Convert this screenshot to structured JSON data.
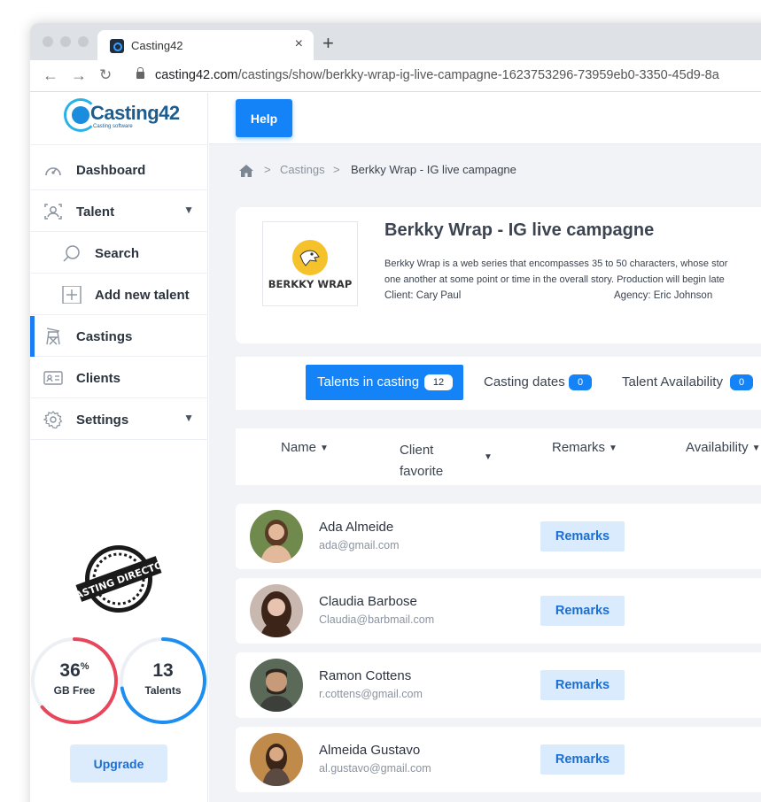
{
  "browser": {
    "tab_title": "Casting42",
    "tab_close": "×",
    "new_tab": "+",
    "url_domain": "casting42.com",
    "url_path": "/castings/show/berkky-wrap-ig-live-campagne-1623753296-73959eb0-3350-45d9-8a"
  },
  "logo": {
    "text": "Casting42",
    "subtitle": "Casting software"
  },
  "sidebar": {
    "items": [
      {
        "label": "Dashboard",
        "icon": "dashboard-icon"
      },
      {
        "label": "Talent",
        "icon": "talent-icon",
        "chevron": "⌄"
      },
      {
        "label": "Search",
        "icon": "search-icon"
      },
      {
        "label": "Add new talent",
        "icon": "add-icon"
      },
      {
        "label": "Castings",
        "icon": "director-chair-icon"
      },
      {
        "label": "Clients",
        "icon": "id-card-icon"
      },
      {
        "label": "Settings",
        "icon": "gear-icon",
        "chevron": "⌄"
      }
    ],
    "stamp_text": "CASTING DIRECTOR",
    "storage": {
      "value": "36",
      "unit": "%",
      "label": "GB Free",
      "fraction": 0.64,
      "color": "#e8465a"
    },
    "talents": {
      "value": "13",
      "label": "Talents",
      "fraction": 0.72,
      "color": "#1b8ef0"
    },
    "upgrade_label": "Upgrade"
  },
  "topbar": {
    "help_label": "Help"
  },
  "breadcrumb": {
    "sep": ">",
    "castings": "Castings",
    "current": "Berkky Wrap - IG live campagne"
  },
  "project": {
    "logo_text": "BERKKY WRAP",
    "title": "Berkky Wrap - IG live campagne",
    "desc_line1": "Berkky Wrap is a web series that encompasses 35 to 50 characters, whose stor",
    "desc_line2": "one another at some point or time in the overall story. Production will begin late",
    "client": "Client: Cary Paul",
    "agency": "Agency: Eric Johnson"
  },
  "tabs": [
    {
      "label": "Talents in casting",
      "count": "12"
    },
    {
      "label": "Casting dates",
      "count": "0"
    },
    {
      "label": "Talent Availability",
      "count": "0"
    }
  ],
  "columns": {
    "name": "Name",
    "client_fav_1": "Client",
    "client_fav_2": "favorite",
    "remarks": "Remarks",
    "availability": "Availability",
    "caret": "⌄"
  },
  "talents": [
    {
      "name": "Ada Almeide",
      "email": "ada@gmail.com",
      "button": "Remarks",
      "skin": "#e3b99c",
      "hair": "#5a3a25",
      "bg": "#6f8a4c"
    },
    {
      "name": "Claudia Barbose",
      "email": "Claudia@barbmail.com",
      "button": "Remarks",
      "skin": "#e8c4b0",
      "hair": "#3c2418",
      "bg": "#c9b8b0"
    },
    {
      "name": "Ramon Cottens",
      "email": "r.cottens@gmail.com",
      "button": "Remarks",
      "skin": "#c79a7a",
      "hair": "#2d2520",
      "bg": "#5b6a58"
    },
    {
      "name": "Almeida Gustavo",
      "email": "al.gustavo@gmail.com",
      "button": "Remarks",
      "skin": "#d9a884",
      "hair": "#3a2518",
      "bg": "#c08a4a"
    }
  ]
}
